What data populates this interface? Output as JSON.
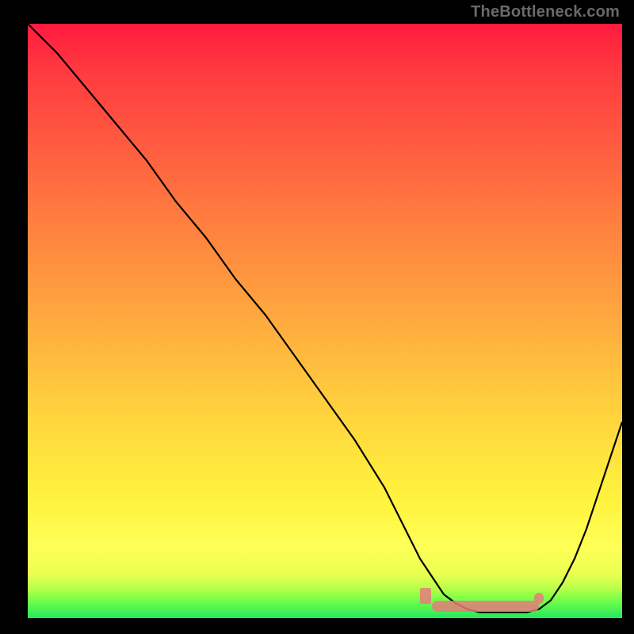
{
  "watermark": "TheBottleneck.com",
  "colors": {
    "curve": "#000000",
    "trough": "#e87b7b"
  },
  "chart_data": {
    "type": "line",
    "title": "",
    "xlabel": "",
    "ylabel": "",
    "xlim": [
      0,
      100
    ],
    "ylim": [
      0,
      100
    ],
    "grid": false,
    "legend": false,
    "x": [
      0,
      5,
      10,
      15,
      20,
      25,
      30,
      35,
      40,
      45,
      50,
      55,
      60,
      62,
      64,
      66,
      68,
      70,
      72,
      74,
      76,
      78,
      80,
      82,
      84,
      86,
      88,
      90,
      92,
      94,
      96,
      98,
      100
    ],
    "y": [
      100,
      95,
      89,
      83,
      77,
      70,
      64,
      57,
      51,
      44,
      37,
      30,
      22,
      18,
      14,
      10,
      7,
      4,
      2.5,
      1.5,
      1,
      1,
      1,
      1,
      1,
      1.5,
      3,
      6,
      10,
      15,
      21,
      27,
      33
    ],
    "trough_band": {
      "x_start": 68,
      "x_end": 86,
      "y": 2
    },
    "markers": [
      {
        "x": 67,
        "y": 3.5,
        "shape": "rect"
      },
      {
        "x": 86,
        "y": 3,
        "shape": "dot"
      }
    ]
  }
}
